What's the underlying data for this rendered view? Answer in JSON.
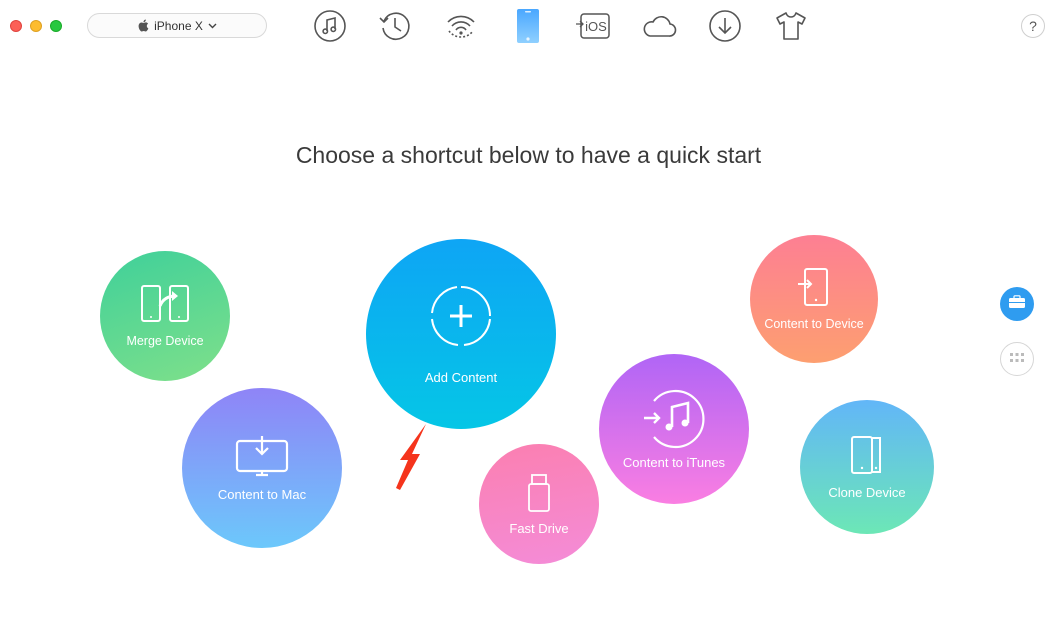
{
  "window": {
    "traffic_lights": {
      "close": "#fc5f57",
      "minimize": "#fdbc2e",
      "maximize": "#28c840"
    }
  },
  "device_selector": {
    "device_name": "iPhone X",
    "icon": "apple-icon",
    "dropdown_icon": "chevron-down-icon"
  },
  "toolbar": {
    "icons": [
      "music-icon",
      "history-icon",
      "wifi-icon",
      "phone-icon",
      "to-ios-icon",
      "cloud-icon",
      "download-icon",
      "tshirt-icon"
    ],
    "active": "phone-icon",
    "to_ios_text": "iOS",
    "accent": "#2f9cf0"
  },
  "help": {
    "label": "?"
  },
  "main": {
    "headline": "Choose a shortcut below to have a quick start"
  },
  "shortcuts": {
    "merge_device": {
      "label": "Merge Device",
      "colors": [
        "#3fd09a",
        "#7fe08a"
      ]
    },
    "add_content": {
      "label": "Add Content",
      "colors": [
        "#0ea5f5",
        "#05c6e6"
      ]
    },
    "content_to_mac": {
      "label": "Content to Mac",
      "colors": [
        "#8f84f7",
        "#6cc8fb"
      ]
    },
    "fast_drive": {
      "label": "Fast Drive",
      "colors": [
        "#fb7fb0",
        "#f48cd8"
      ]
    },
    "content_to_itunes": {
      "label": "Content to iTunes",
      "colors": [
        "#b065f6",
        "#fa7ee2"
      ]
    },
    "content_to_device": {
      "label": "Content to Device",
      "colors": [
        "#fd7f93",
        "#fd9f70"
      ]
    },
    "clone_device": {
      "label": "Clone Device",
      "colors": [
        "#62b6f8",
        "#6ce7b6"
      ]
    }
  },
  "side_panel": {
    "icons": [
      "toolbox-icon",
      "grid-icon"
    ],
    "active": "toolbox-icon"
  },
  "annotation": {
    "arrow_color": "#f5341c"
  }
}
